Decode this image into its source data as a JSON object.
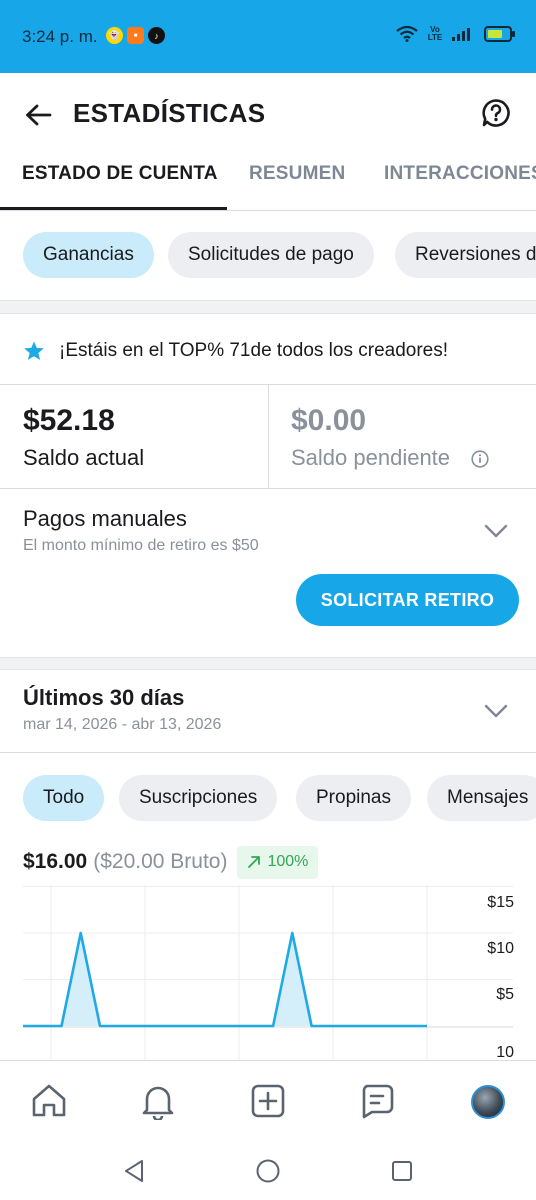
{
  "status_bar": {
    "time": "3:24 p. m.",
    "volte": "Vo LTE",
    "bg_color": "#17a7e8"
  },
  "header": {
    "title": "ESTADÍSTICAS",
    "back_icon": "arrow-left-icon",
    "help_icon": "help-circle-icon"
  },
  "tabs": [
    {
      "label": "ESTADO DE CUENTA",
      "active": true
    },
    {
      "label": "RESUMEN",
      "active": false
    },
    {
      "label": "INTERACCIONES",
      "active": false
    }
  ],
  "filter_chips": [
    {
      "label": "Ganancias",
      "active": true
    },
    {
      "label": "Solicitudes de pago",
      "active": false
    },
    {
      "label": "Reversiones de",
      "active": false
    }
  ],
  "ranking": {
    "icon": "star-icon",
    "text": "¡Estáis en el TOP% 71de todos los creadores!"
  },
  "balance": {
    "current_amount": "$52.18",
    "current_label": "Saldo actual",
    "pending_amount": "$0.00",
    "pending_label": "Saldo pendiente"
  },
  "payouts": {
    "title": "Pagos manuales",
    "subtitle": "El monto mínimo de retiro es $50",
    "button_label": "SOLICITAR RETIRO"
  },
  "period": {
    "title": "Últimos 30 días",
    "range": "mar 14, 2026 - abr 13, 2026"
  },
  "type_chips": [
    {
      "label": "Todo",
      "active": true
    },
    {
      "label": "Suscripciones",
      "active": false
    },
    {
      "label": "Propinas",
      "active": false
    },
    {
      "label": "Mensajes",
      "active": false
    }
  ],
  "totals": {
    "net": "$16.00",
    "gross": "($20.00 Bruto)",
    "growth": "100%",
    "growth_icon": "trend-up-icon"
  },
  "chart_data": {
    "type": "area",
    "y_ticks": [
      "$15",
      "$10",
      "$5",
      "10"
    ],
    "ylim": [
      0,
      15
    ],
    "values": [
      0,
      0,
      0,
      10,
      0,
      0,
      0,
      0,
      0,
      0,
      0,
      0,
      0,
      0,
      10,
      0,
      0,
      0,
      0,
      0,
      0,
      0
    ],
    "grid": true,
    "line_color": "#1fa9e6",
    "fill_color": "#d4eefa"
  },
  "bottom_nav": [
    {
      "name": "home-icon"
    },
    {
      "name": "bell-icon"
    },
    {
      "name": "add-square-icon"
    },
    {
      "name": "messages-icon"
    },
    {
      "name": "profile-avatar"
    }
  ],
  "system_nav": [
    "back-triangle-icon",
    "home-circle-icon",
    "recents-square-icon"
  ]
}
